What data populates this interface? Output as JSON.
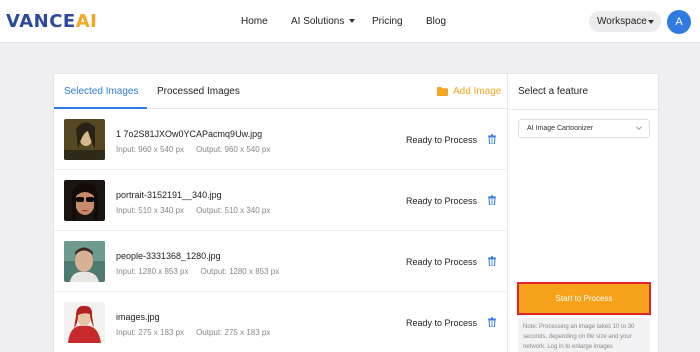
{
  "header": {
    "logo_part1": "VANCE",
    "logo_part2": "AI",
    "nav": [
      {
        "label": "Home"
      },
      {
        "label": "AI Solutions"
      },
      {
        "label": "Pricing"
      },
      {
        "label": "Blog"
      }
    ],
    "workspace_label": "Workspace",
    "avatar_initial": "A"
  },
  "tabs": {
    "selected": "Selected Images",
    "processed": "Processed Images",
    "add_image": "Add Image"
  },
  "images": [
    {
      "filename": "1 7o2S81JXOw0YCAPacmq9Uw.jpg",
      "input": "Input: 960 x 540 px",
      "output": "Output: 960 x 540 px",
      "status": "Ready to Process"
    },
    {
      "filename": "portrait-3152191__340.jpg",
      "input": "Input: 510 x 340 px",
      "output": "Output: 510 x 340 px",
      "status": "Ready to Process"
    },
    {
      "filename": "people-3331368_1280.jpg",
      "input": "Input: 1280 x 853 px",
      "output": "Output: 1280 x 853 px",
      "status": "Ready to Process"
    },
    {
      "filename": "images.jpg",
      "input": "Input: 275 x 183 px",
      "output": "Output: 275 x 183 px",
      "status": "Ready to Process"
    }
  ],
  "feature": {
    "title": "Select a feature",
    "selected": "AI Image Cartoonizer",
    "start_button": "Start to Process",
    "note": "Note: Processing an image takes 10 to 30 seconds, depending on file size and your network. Log in to enlarge images"
  },
  "colors": {
    "accent_blue": "#2f7be0",
    "accent_orange": "#f7a21b",
    "highlight_red": "#e0232b"
  }
}
